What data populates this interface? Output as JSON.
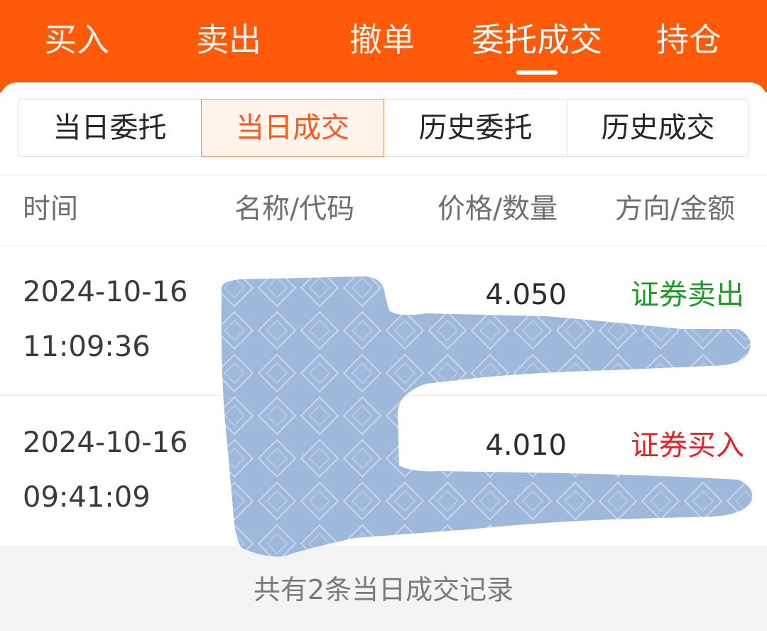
{
  "top_tabs": [
    "买入",
    "卖出",
    "撤单",
    "委托成交",
    "持仓"
  ],
  "sub_tabs": [
    "当日委托",
    "当日成交",
    "历史委托",
    "历史成交"
  ],
  "table": {
    "headers": [
      "时间",
      "名称/代码",
      "价格/数量",
      "方向/金额"
    ],
    "rows": [
      {
        "date": "2024-10-16",
        "time": "11:09:36",
        "price": "4.050",
        "direction": "证券卖出",
        "direction_color": "#1f9a2a"
      },
      {
        "date": "2024-10-16",
        "time": "09:41:09",
        "price": "4.010",
        "direction": "证券买入",
        "direction_color": "#e0242a"
      }
    ]
  },
  "footer": "共有2条当日成交记录",
  "colors": {
    "accent": "#ff5a0a",
    "sell": "#1f9a2a",
    "buy": "#e0242a"
  }
}
